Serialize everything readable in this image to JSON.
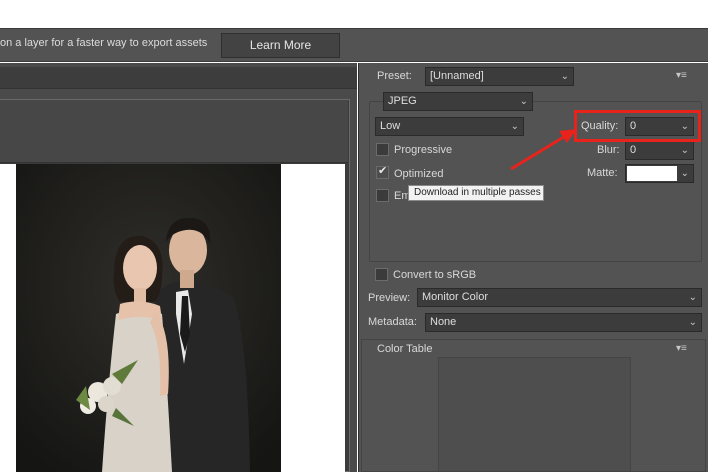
{
  "infobar": {
    "message": "on a layer for a faster way to export assets",
    "learn_more": "Learn More"
  },
  "settings": {
    "preset_label": "Preset:",
    "preset_value": "[Unnamed]",
    "format_value": "JPEG",
    "quality_preset_value": "Low",
    "quality_label": "Quality:",
    "quality_value": "0",
    "blur_label": "Blur:",
    "blur_value": "0",
    "matte_label": "Matte:",
    "progressive_label": "Progressive",
    "progressive_checked": false,
    "optimized_label": "Optimized",
    "optimized_checked": true,
    "embed_label_partial": "Em",
    "tooltip": "Download in multiple passes",
    "convert_srgb_label": "Convert to sRGB",
    "convert_srgb_checked": false,
    "preview_label": "Preview:",
    "preview_value": "Monitor Color",
    "metadata_label": "Metadata:",
    "metadata_value": "None",
    "color_table_label": "Color Table"
  },
  "icons": {
    "dropdown": "chevron-down-icon",
    "panel_menu": "panel-menu-icon",
    "checkmark": "checkmark-icon"
  },
  "colors": {
    "highlight": "#e8231b",
    "panel_bg": "#535353",
    "matte_swatch": "#ffffff"
  }
}
